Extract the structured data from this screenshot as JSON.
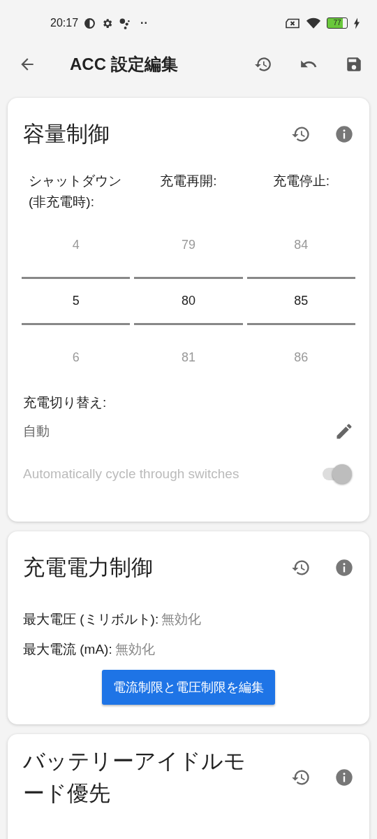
{
  "status_bar": {
    "time": "20:17",
    "more": "··",
    "battery": "77"
  },
  "app_bar": {
    "title": "ACC 設定編集"
  },
  "capacity_card": {
    "title": "容量制御",
    "pickers": [
      {
        "label": "シャットダウン (非充電時):",
        "previous": "4",
        "value": "5",
        "next": "6"
      },
      {
        "label": "充電再開:",
        "previous": "79",
        "value": "80",
        "next": "81"
      },
      {
        "label": "充電停止:",
        "previous": "84",
        "value": "85",
        "next": "86"
      }
    ],
    "switch_label": "充電切り替え:",
    "switch_value": "自動",
    "cycle": {
      "label": "Automatically cycle through switches",
      "on": true,
      "disabled": true
    }
  },
  "power_card": {
    "title": "充電電力制御",
    "rows": [
      {
        "label": "最大電圧 (ミリボルト):",
        "value": "無効化"
      },
      {
        "label": "最大電流 (mA):",
        "value": "無効化"
      }
    ],
    "button": "電流制限と電圧制限を編集"
  },
  "idle_card": {
    "title": "バッテリーアイドルモード優先"
  }
}
